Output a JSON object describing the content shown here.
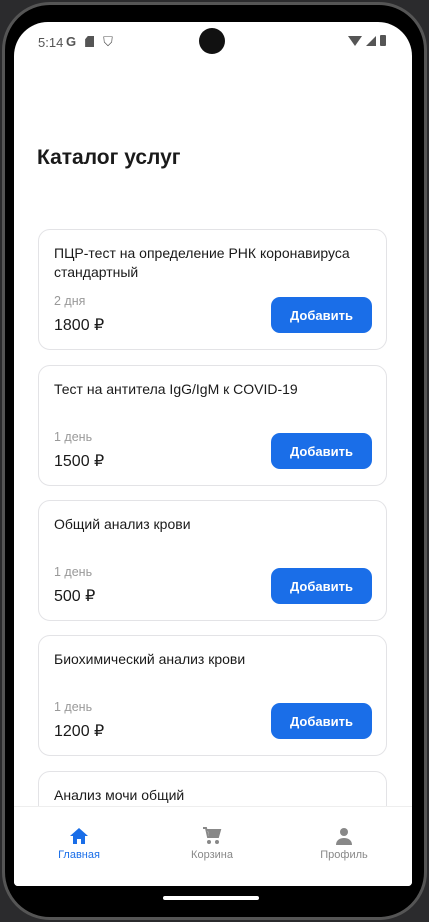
{
  "status": {
    "time": "5:14",
    "left_icons": [
      "google-icon",
      "sd-card-icon",
      "shield-icon"
    ],
    "right_icons": [
      "wifi-icon",
      "signal-icon",
      "battery-icon"
    ]
  },
  "page_title": "Каталог услуг",
  "button_label": "Добавить",
  "colors": {
    "accent": "#1a6ee8"
  },
  "services": [
    {
      "title": "ПЦР-тест на определение РНК коронавируса стандартный",
      "duration": "2 дня",
      "price": "1800 ₽"
    },
    {
      "title": "Тест на антитела IgG/IgM к COVID-19",
      "duration": "1 день",
      "price": "1500 ₽"
    },
    {
      "title": "Общий анализ крови",
      "duration": "1 день",
      "price": "500 ₽"
    },
    {
      "title": "Биохимический анализ крови",
      "duration": "1 день",
      "price": "1200 ₽"
    },
    {
      "title": "Анализ мочи общий"
    }
  ],
  "nav": [
    {
      "label": "Главная",
      "icon": "home-icon"
    },
    {
      "label": "Корзина",
      "icon": "cart-icon"
    },
    {
      "label": "Профиль",
      "icon": "person-icon"
    }
  ]
}
